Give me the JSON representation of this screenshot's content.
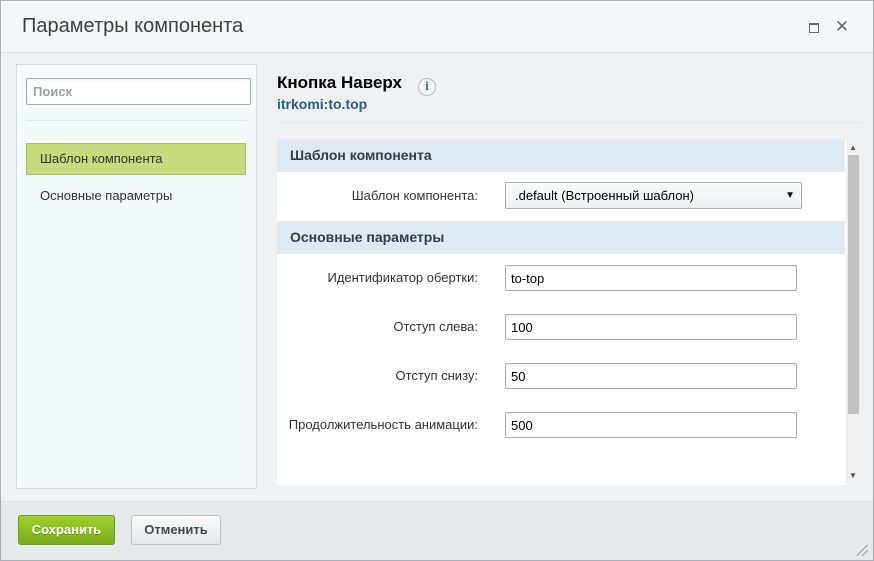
{
  "dialog": {
    "title": "Параметры компонента"
  },
  "sidebar": {
    "search_placeholder": "Поиск",
    "items": [
      {
        "label": "Шаблон компонента",
        "active": true
      },
      {
        "label": "Основные параметры",
        "active": false
      }
    ]
  },
  "component": {
    "name": "Кнопка Наверх",
    "code": "itrkomi:to.top",
    "info_icon": "info-icon"
  },
  "sections": {
    "template": {
      "title": "Шаблон компонента",
      "template_label": "Шаблон компонента:",
      "template_value": ".default (Встроенный шаблон)"
    },
    "main": {
      "title": "Основные параметры",
      "fields": [
        {
          "label": "Идентификатор обертки:",
          "value": "to-top"
        },
        {
          "label": "Отступ слева:",
          "value": "100"
        },
        {
          "label": "Отступ снизу:",
          "value": "50"
        },
        {
          "label": "Продолжительность анимации:",
          "value": "500"
        }
      ]
    }
  },
  "footer": {
    "save_label": "Сохранить",
    "cancel_label": "Отменить"
  },
  "colors": {
    "accent_green": "#8cc21f",
    "active_item": "#c7da7c",
    "section_bg": "#dfe9f1",
    "link_blue": "#2a5d8f"
  }
}
